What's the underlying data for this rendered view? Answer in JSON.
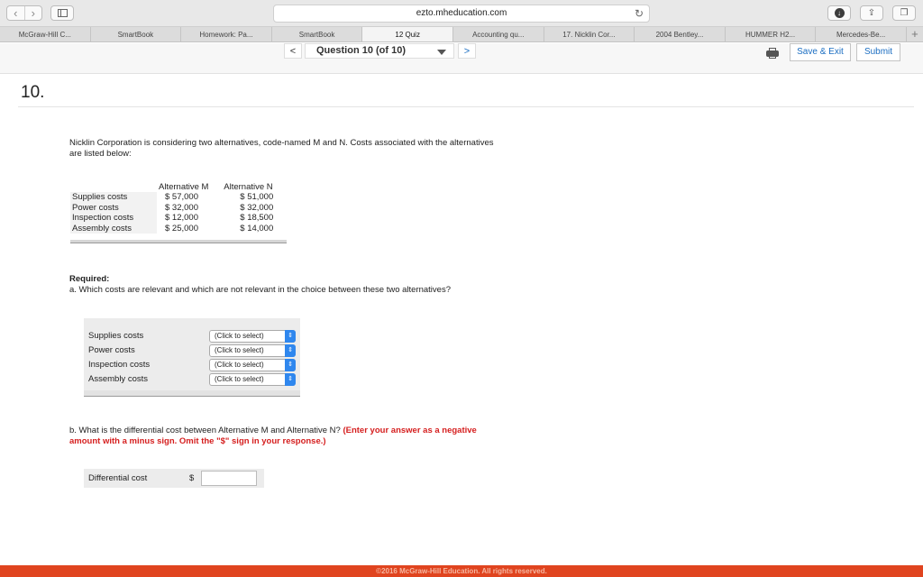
{
  "browser": {
    "url": "ezto.mheducation.com",
    "tabs": [
      "McGraw-Hill C...",
      "SmartBook",
      "Homework: Pa...",
      "SmartBook",
      "12 Quiz",
      "Accounting qu...",
      "17. Nicklin Cor...",
      "2004 Bentley...",
      "HUMMER H2...",
      "Mercedes-Be..."
    ],
    "active_tab_index": 4,
    "new_tab_label": "+"
  },
  "header": {
    "prev_label": "<",
    "next_label": ">",
    "question_select": "Question 10 (of 10)",
    "save_exit_label": "Save & Exit",
    "submit_label": "Submit"
  },
  "question": {
    "number": "10.",
    "intro": "Nicklin Corporation is considering two alternatives, code-named M and N. Costs associated with the alternatives are listed below:",
    "table": {
      "headers": [
        "",
        "Alternative M",
        "Alternative N"
      ],
      "rows": [
        [
          "Supplies costs",
          "$ 57,000",
          "$ 51,000"
        ],
        [
          "Power costs",
          "$ 32,000",
          "$ 32,000"
        ],
        [
          "Inspection costs",
          "$ 12,000",
          "$ 18,500"
        ],
        [
          "Assembly costs",
          "$ 25,000",
          "$ 14,000"
        ]
      ]
    },
    "required_label": "Required:",
    "part_a": "a.  Which costs are relevant and which are not relevant in the choice between these two alternatives?",
    "part_a_rows": [
      {
        "label": "Supplies costs",
        "value": "(Click to select)"
      },
      {
        "label": "Power costs",
        "value": "(Click to select)"
      },
      {
        "label": "Inspection costs",
        "value": "(Click to select)"
      },
      {
        "label": "Assembly costs",
        "value": "(Click to select)"
      }
    ],
    "part_b": "b.  What is the differential cost between Alternative M and Alternative N?",
    "part_b_note": "(Enter your answer as a negative amount with a minus sign. Omit the \"$\" sign in your response.)",
    "differential_label": "Differential cost",
    "currency": "$",
    "differential_value": ""
  },
  "footer": {
    "copyright": "©2016 McGraw-Hill Education. All rights reserved."
  }
}
